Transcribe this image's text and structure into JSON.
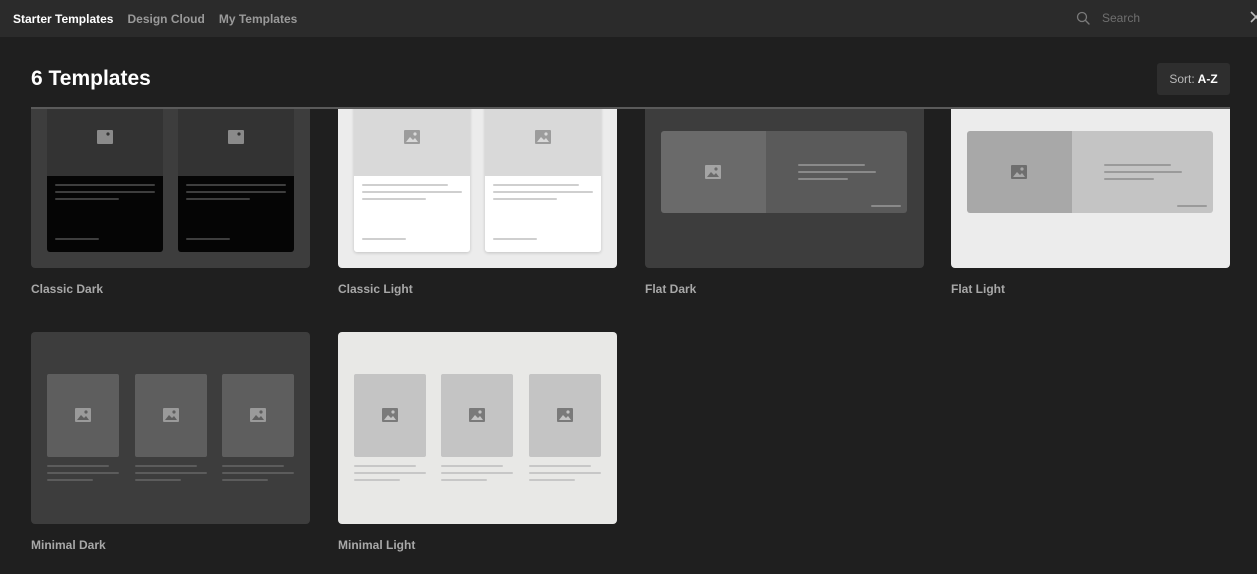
{
  "topbar": {
    "tabs": [
      {
        "label": "Starter Templates",
        "active": true
      },
      {
        "label": "Design Cloud",
        "active": false
      },
      {
        "label": "My Templates",
        "active": false
      }
    ],
    "search": {
      "placeholder": "Search",
      "value": ""
    },
    "search_icon": "search-icon",
    "close_icon": "close-icon"
  },
  "header": {
    "title": "6 Templates",
    "sort": {
      "label": "Sort:",
      "value": "A-Z"
    }
  },
  "templates": [
    {
      "label": "Classic Dark",
      "style": "classic",
      "theme": "dark"
    },
    {
      "label": "Classic Light",
      "style": "classic",
      "theme": "light"
    },
    {
      "label": "Flat Dark",
      "style": "flat",
      "theme": "dark"
    },
    {
      "label": "Flat Light",
      "style": "flat",
      "theme": "light"
    },
    {
      "label": "Minimal Dark",
      "style": "minimal",
      "theme": "dark"
    },
    {
      "label": "Minimal Light",
      "style": "minimal",
      "theme": "light"
    }
  ],
  "colors": {
    "background": "#1f1f1f",
    "topbar": "#2b2b2b",
    "active_tab": "#ffffff",
    "inactive_tab": "#9a9a9a",
    "card_dark": "#3d3d3d",
    "card_light": "#ececec"
  }
}
